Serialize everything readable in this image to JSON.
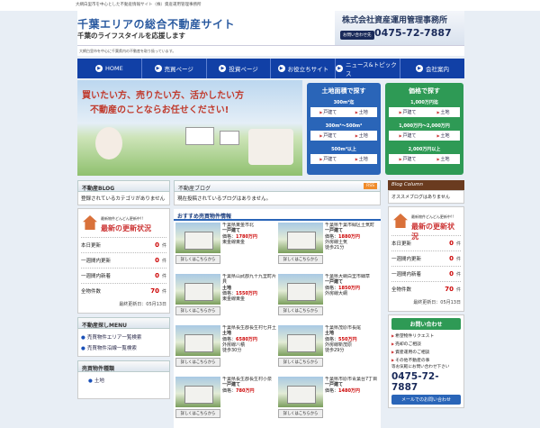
{
  "topbar": {
    "text": "大網白里市を中心とした不動産情報サイト（株）資産運用管理事務所"
  },
  "header": {
    "title": "千葉エリアの総合不動産サイト",
    "subtitle": "千葉のライフスタイルを応援します",
    "company": "株式会社資産運用管理事務所",
    "contact_label": "お問い合わせ先",
    "phone": "0475-72-7887"
  },
  "subbar": {
    "text": "大網白里市を中心に千葉県内の不動産を取り扱っています。"
  },
  "nav": [
    {
      "label": "HOME"
    },
    {
      "label": "売買ページ"
    },
    {
      "label": "投資ページ"
    },
    {
      "label": "お役立ちサイト"
    },
    {
      "label": "ニュース&トピックス"
    },
    {
      "label": "会社案内"
    }
  ],
  "hero": {
    "line1": "買いたい方、売りたい方、活かしたい方",
    "line2": "不動産のことならお任せください!"
  },
  "area_search": {
    "title": "土地面積で探す",
    "groups": [
      {
        "range": "300m²迄",
        "links": [
          "戸建て",
          "土地"
        ]
      },
      {
        "range": "300m²～500m²",
        "links": [
          "戸建て",
          "土地"
        ]
      },
      {
        "range": "500m²以上",
        "links": [
          "戸建て",
          "土地"
        ]
      }
    ]
  },
  "price_search": {
    "title": "価格で探す",
    "groups": [
      {
        "range": "1,000万円迄",
        "links": [
          "戸建て",
          "土地"
        ]
      },
      {
        "range": "1,000万円～2,000万円",
        "links": [
          "戸建て",
          "土地"
        ]
      },
      {
        "range": "2,000万円以上",
        "links": [
          "戸建て",
          "土地"
        ]
      }
    ]
  },
  "left": {
    "blog_head": "不動産BLOG",
    "blog_text": "登録されているカテゴリがありません",
    "rank_sub": "最新物件どんどん更新中!!",
    "rank_title": "最新の更新状況",
    "stats": [
      {
        "label": "本日更新",
        "value": "0",
        "unit": "件"
      },
      {
        "label": "一週間内更新",
        "value": "0",
        "unit": "件"
      },
      {
        "label": "一週間内新着",
        "value": "0",
        "unit": "件"
      },
      {
        "label": "全物件数",
        "value": "70",
        "unit": "件"
      }
    ],
    "update": "最終更新日：05月13日",
    "menu_head": "不動産探しMENU",
    "menu_items": [
      "売買物件エリア一覧検索",
      "売買物件沿線一覧検索"
    ],
    "types_head": "売買物件種類",
    "type_item": "土地"
  },
  "center": {
    "blog_head": "不動産ブログ",
    "rss": "RSS",
    "blog_text": "現在投稿されているブログはありません。",
    "props_head": "おすすめ売買物件情報",
    "btn": "詳しくはこちらから",
    "props": [
      {
        "addr": "千葉県東金市北",
        "type": "一戸建て",
        "price_label": "価格：",
        "price": "1780万円",
        "line": "東金線東金"
      },
      {
        "addr": "千葉県千葉市緑区土気町",
        "type": "一戸建て",
        "price_label": "価格：",
        "price": "1880万円",
        "line": "外房線土気",
        "walk": "徒歩21分"
      },
      {
        "addr": "千葉県山武郡九十九里町片貝",
        "type": "土地",
        "price_label": "価格：",
        "price": "1550万円",
        "line": "東金線東金"
      },
      {
        "addr": "千葉県大網白里市細草",
        "type": "一戸建て",
        "price_label": "価格：",
        "price": "1850万円",
        "line": "外房線大網"
      },
      {
        "addr": "千葉県長生郡長生村七井土",
        "type": "土地",
        "price_label": "価格：",
        "price": "6580万円",
        "line": "外房線八積",
        "walk": "徒歩30分"
      },
      {
        "addr": "千葉県茂原市長尾",
        "type": "土地",
        "price_label": "価格：",
        "price": "550万円",
        "line": "外房線新茂原",
        "walk": "徒歩29分"
      },
      {
        "addr": "千葉県長生郡長生村小泉",
        "type": "一戸建て",
        "price_label": "価格：",
        "price": "780万円",
        "line": ""
      },
      {
        "addr": "千葉県市原市青葉台7丁目",
        "type": "一戸建て",
        "price_label": "価格：",
        "price": "1480万円",
        "line": ""
      }
    ]
  },
  "right": {
    "blog_head": "Blog Column",
    "blog_text": "オススメブログはありません",
    "rank_sub": "最新物件どんどん更新中!!",
    "rank_title": "最新の更新状況",
    "stats": [
      {
        "label": "本日更新",
        "value": "0",
        "unit": "件"
      },
      {
        "label": "一週間内更新",
        "value": "0",
        "unit": "件"
      },
      {
        "label": "一週間内新着",
        "value": "0",
        "unit": "件"
      },
      {
        "label": "全物件数",
        "value": "70",
        "unit": "件"
      }
    ],
    "update": "最終更新日：05月13日",
    "inquiry_title": "お問い合わせ",
    "inquiry_items": [
      "希望物件リクエスト",
      "売却のご相談",
      "資産運用のご相談",
      "その他不動産の事"
    ],
    "inquiry_note": "等お気軽にお問い合わせ下さい",
    "phone": "0475-72-7887",
    "mail": "メールでのお問い合わせ"
  }
}
